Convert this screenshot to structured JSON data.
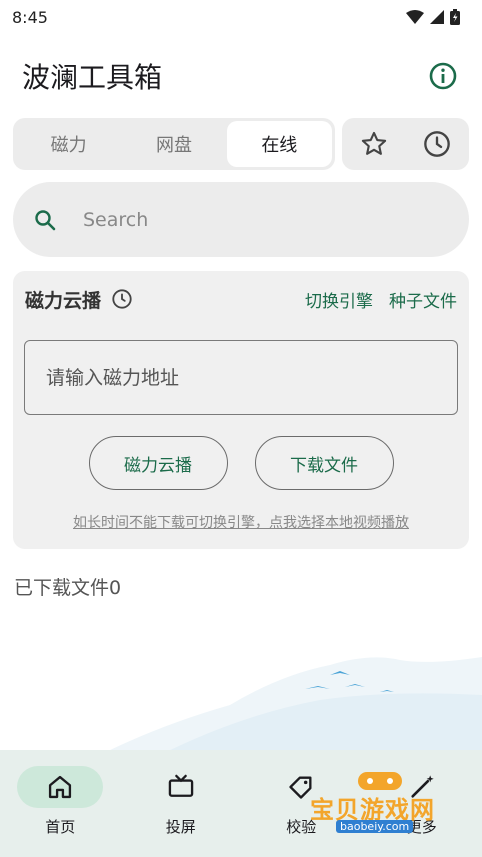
{
  "status": {
    "time": "8:45"
  },
  "app": {
    "title": "波澜工具箱"
  },
  "tabs": [
    {
      "label": "磁力",
      "active": false
    },
    {
      "label": "网盘",
      "active": false
    },
    {
      "label": "在线",
      "active": true
    }
  ],
  "search": {
    "placeholder": "Search"
  },
  "card": {
    "title": "磁力云播",
    "link_switch_engine": "切换引擎",
    "link_torrent_file": "种子文件",
    "input_placeholder": "请输入磁力地址",
    "btn_stream": "磁力云播",
    "btn_download": "下载文件",
    "hint": "如长时间不能下载可切换引擎，点我选择本地视频播放"
  },
  "downloaded_label": "已下载文件0",
  "nav": [
    {
      "label": "首页",
      "icon": "home-icon",
      "active": true
    },
    {
      "label": "投屏",
      "icon": "tv-icon",
      "active": false
    },
    {
      "label": "校验",
      "icon": "tag-icon",
      "active": false
    },
    {
      "label": "更多",
      "icon": "wand-icon",
      "active": false
    }
  ],
  "watermark": {
    "text": "宝贝游戏网",
    "url": "baobeiy.com"
  },
  "colors": {
    "accent": "#1b6b4a",
    "nav_active": "#cde8da",
    "surface": "#ececec"
  }
}
